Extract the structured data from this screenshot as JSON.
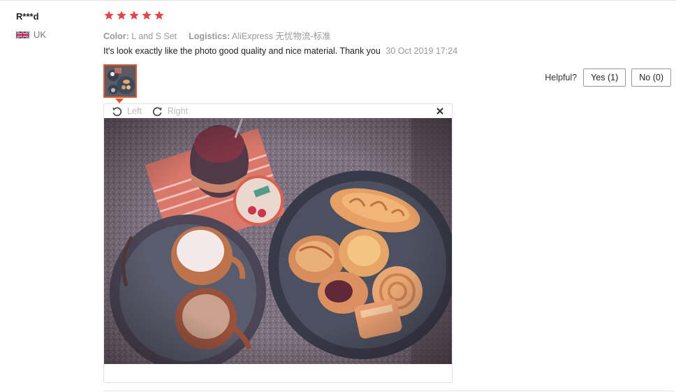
{
  "buyer": {
    "name": "R***d",
    "country": "UK"
  },
  "rating": {
    "stars": 5,
    "max": 5,
    "color": "#e0464a"
  },
  "details": {
    "color_key": "Color:",
    "color_value": "L and S Set",
    "logistics_key": "Logistics:",
    "logistics_value": "AliExpress 无忧物流-标准"
  },
  "review": {
    "text": "It's look exactly like the photo good quality and nice material. Thank you",
    "date": "30 Oct 2019 17:24"
  },
  "helpful": {
    "label": "Helpful?",
    "yes": "Yes (1)",
    "no": "No (0)"
  },
  "viewer": {
    "rotate_left": "Left",
    "rotate_right": "Right",
    "close_icon": "close-icon"
  },
  "colors": {
    "accent": "#e05a2b",
    "star": "#e0464a",
    "muted": "#999999"
  }
}
